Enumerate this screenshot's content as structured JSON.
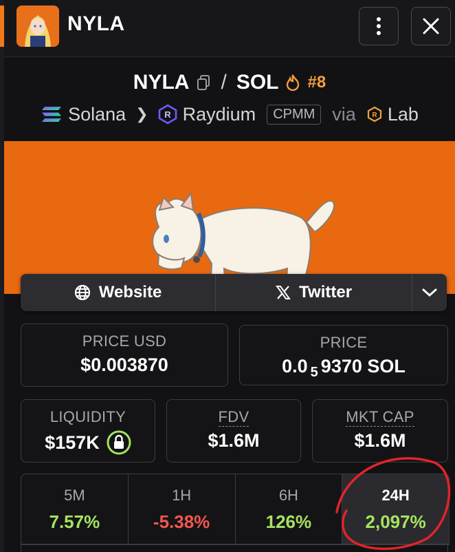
{
  "header": {
    "title": "NYLA"
  },
  "pair": {
    "base": "NYLA",
    "separator": "/",
    "quote": "SOL",
    "rank": "#8"
  },
  "route": {
    "chain": "Solana",
    "dex": "Raydium",
    "pool_type": "CPMM",
    "via": "via",
    "source": "Lab"
  },
  "links": {
    "website": "Website",
    "twitter": "Twitter"
  },
  "stats": {
    "price_usd_label": "PRICE USD",
    "price_usd_value": "$0.003870",
    "price_label": "PRICE",
    "price_prefix": "0.0",
    "price_zero_count": "5",
    "price_digits": "9370 SOL",
    "liquidity_label": "LIQUIDITY",
    "liquidity_value": "$157K",
    "fdv_label": "FDV",
    "fdv_value": "$1.6M",
    "mktcap_label": "MKT CAP",
    "mktcap_value": "$1.6M"
  },
  "timeframes": [
    {
      "label": "5M",
      "value": "7.57%"
    },
    {
      "label": "1H",
      "value": "-5.38%"
    },
    {
      "label": "6H",
      "value": "126%"
    },
    {
      "label": "24H",
      "value": "2,097%"
    }
  ],
  "colors": {
    "accent_orange": "#e8690f",
    "positive": "#a6e35f",
    "negative": "#f2574d",
    "annotation_red": "#e0242a"
  },
  "icons": [
    "menu-dots-icon",
    "close-icon",
    "copy-icon",
    "flame-icon",
    "solana-icon",
    "raydium-icon",
    "lab-icon",
    "globe-icon",
    "x-logo-icon",
    "chevron-down-icon",
    "lock-icon"
  ]
}
